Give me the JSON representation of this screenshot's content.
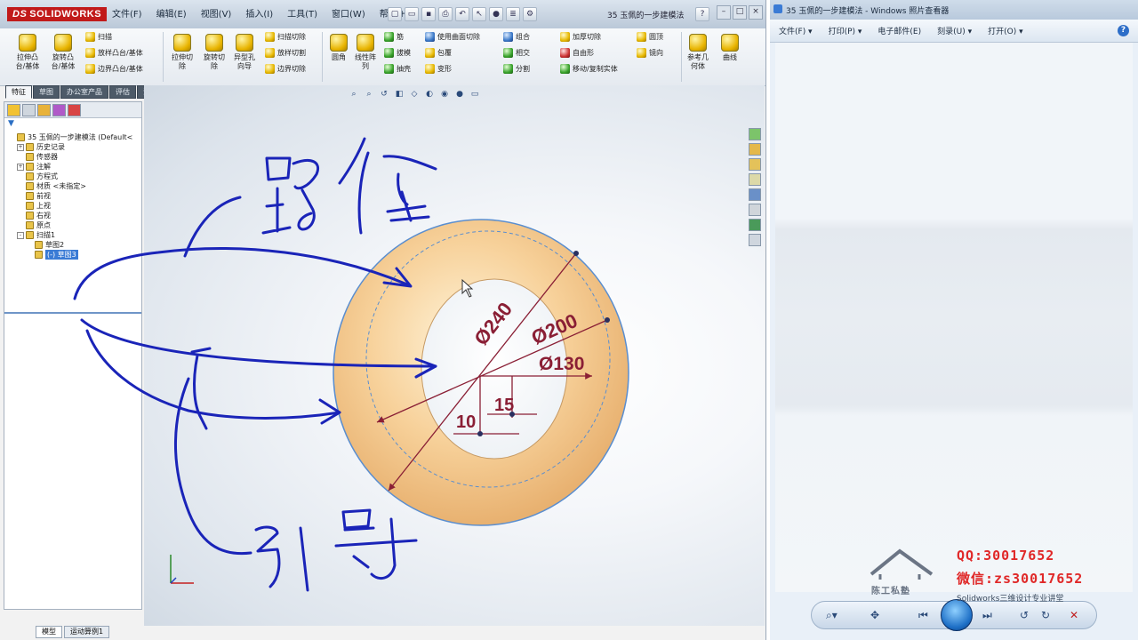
{
  "solidworks": {
    "logo": "SOLIDWORKS",
    "menus": [
      "文件(F)",
      "编辑(E)",
      "视图(V)",
      "插入(I)",
      "工具(T)",
      "窗口(W)",
      "帮助(H)"
    ],
    "doc_title": "35 玉佩的一步建模法",
    "ribbon": {
      "big": [
        {
          "name": "extrude-boss-button",
          "label": "拉伸凸\n台/基体"
        },
        {
          "name": "revolve-boss-button",
          "label": "旋转凸\n台/基体"
        },
        {
          "name": "extrude-cut-button",
          "label": "拉伸切\n除"
        },
        {
          "name": "revolve-cut-button",
          "label": "旋转切\n除"
        },
        {
          "name": "boundary-cut-button",
          "label": "异型孔\n向导"
        },
        {
          "name": "fillet-button",
          "label": "圆角"
        },
        {
          "name": "linear-pattern-button",
          "label": "线性阵\n列"
        },
        {
          "name": "reference-geometry-button",
          "label": "参考几\n何体"
        },
        {
          "name": "curves-button",
          "label": "曲线"
        }
      ],
      "small": [
        {
          "name": "sweep-button",
          "label": "扫描"
        },
        {
          "name": "loft-button",
          "label": "放样凸台/基体"
        },
        {
          "name": "boundary-boss-button",
          "label": "边界凸台/基体"
        },
        {
          "name": "sweep-cut-button",
          "label": "扫描切除"
        },
        {
          "name": "loft-cut-button",
          "label": "放样切割"
        },
        {
          "name": "boundary-cut-small-button",
          "label": "边界切除"
        },
        {
          "name": "rib-button",
          "label": "筋"
        },
        {
          "name": "draft-button",
          "label": "拔模"
        },
        {
          "name": "shell-button",
          "label": "抽壳"
        },
        {
          "name": "wrap-button",
          "label": "包覆"
        },
        {
          "name": "intersect-button",
          "label": "相交"
        },
        {
          "name": "mirror-button",
          "label": "镜向"
        },
        {
          "name": "curve-driven-pattern-button",
          "label": "使用曲面切除"
        },
        {
          "name": "combine-button",
          "label": "组合"
        },
        {
          "name": "split-button",
          "label": "分割"
        },
        {
          "name": "thicken-button",
          "label": "加厚切除"
        },
        {
          "name": "move-copy-button",
          "label": "移动/复制实体"
        },
        {
          "name": "dome-button",
          "label": "圆顶"
        },
        {
          "name": "freeform-button",
          "label": "自由形"
        },
        {
          "name": "deform-button",
          "label": "变形"
        }
      ]
    },
    "tabs": [
      "特征",
      "草图",
      "办公室产品",
      "评估",
      "渲染工具"
    ],
    "active_tab": "特征",
    "tree": [
      {
        "label": "35 玉佩的一步建模法 (Default<",
        "exp": "",
        "indent": 0
      },
      {
        "label": "历史记录",
        "exp": "+",
        "indent": 1
      },
      {
        "label": "传感器",
        "exp": "",
        "indent": 1
      },
      {
        "label": "注解",
        "exp": "+",
        "indent": 1
      },
      {
        "label": "方程式",
        "exp": "",
        "indent": 1
      },
      {
        "label": "材质 <未指定>",
        "exp": "",
        "indent": 1
      },
      {
        "label": "前视",
        "exp": "",
        "indent": 1
      },
      {
        "label": "上视",
        "exp": "",
        "indent": 1
      },
      {
        "label": "右视",
        "exp": "",
        "indent": 1
      },
      {
        "label": "原点",
        "exp": "",
        "indent": 1
      },
      {
        "label": "扫描1",
        "exp": "-",
        "indent": 1
      },
      {
        "label": "草图2",
        "exp": "",
        "indent": 2
      },
      {
        "label": "(-) 草图3",
        "exp": "",
        "indent": 2,
        "selected": true
      }
    ],
    "model_tab": "模型",
    "bottom_tabs": [
      "模型",
      "运动算例1"
    ],
    "dimensions": {
      "d1": "Ø240",
      "d2": "Ø200",
      "d3": "Ø130",
      "d4": "15",
      "d5": "10"
    },
    "annotations": {
      "path": "路径",
      "guide": "引导"
    }
  },
  "photo_viewer": {
    "title": "35 玉佩的一步建模法 - Windows 照片查看器",
    "menus": [
      "文件(F) ▾",
      "打印(P) ▾",
      "电子邮件(E)",
      "刻录(U) ▾",
      "打开(O) ▾"
    ],
    "help": "?"
  },
  "watermark": {
    "caption": "陈工私塾",
    "qq": "QQ:30017652",
    "wechat": "微信:zs30017652",
    "sub": "Solidworks三维设计专业讲堂"
  },
  "colors": {
    "ring_fill": "#f6cf95",
    "ring_stroke": "#5a8ecf",
    "dim_color": "#8a1f35",
    "pen_color": "#1a24b8",
    "watermark_red": "#e02828"
  }
}
